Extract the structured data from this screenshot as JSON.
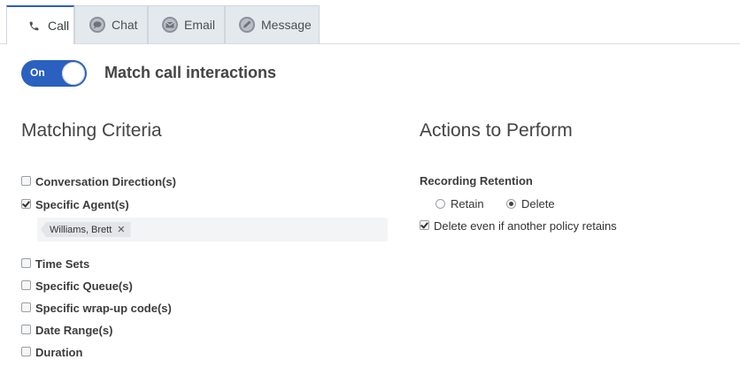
{
  "tabs": [
    {
      "label": "Call",
      "icon": "phone-icon",
      "active": true
    },
    {
      "label": "Chat",
      "icon": "chat-icon",
      "active": false
    },
    {
      "label": "Email",
      "icon": "email-icon",
      "active": false
    },
    {
      "label": "Message",
      "icon": "message-icon",
      "active": false
    }
  ],
  "toggle": {
    "state_label": "On",
    "title": "Match call interactions"
  },
  "matching": {
    "heading": "Matching Criteria",
    "criteria": [
      {
        "label": "Conversation Direction(s)",
        "checked": false
      },
      {
        "label": "Specific Agent(s)",
        "checked": true
      },
      {
        "label": "Time Sets",
        "checked": false
      },
      {
        "label": "Specific Queue(s)",
        "checked": false
      },
      {
        "label": "Specific wrap-up code(s)",
        "checked": false
      },
      {
        "label": "Date Range(s)",
        "checked": false
      },
      {
        "label": "Duration",
        "checked": false
      }
    ],
    "agents": [
      "Williams, Brett"
    ]
  },
  "actions": {
    "heading": "Actions to Perform",
    "retention_label": "Recording Retention",
    "options": [
      {
        "label": "Retain",
        "selected": false
      },
      {
        "label": "Delete",
        "selected": true
      }
    ],
    "delete_even": {
      "label": "Delete even if another policy retains",
      "checked": true
    }
  },
  "colors": {
    "accent": "#2a60c0"
  }
}
